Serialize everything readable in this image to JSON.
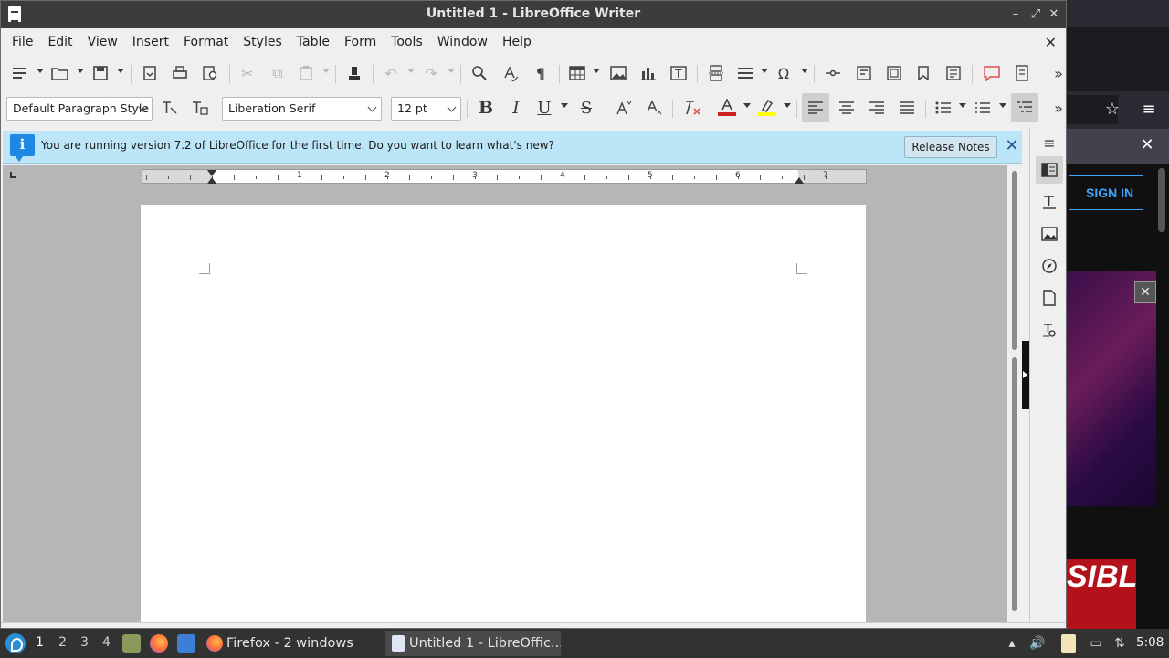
{
  "window": {
    "title": "Untitled 1 - LibreOffice Writer",
    "minimize_glyph": "–",
    "maximize_glyph": "⤢",
    "close_glyph": "✕"
  },
  "menubar": {
    "items": [
      "File",
      "Edit",
      "View",
      "Insert",
      "Format",
      "Styles",
      "Table",
      "Form",
      "Tools",
      "Window",
      "Help"
    ],
    "close_document_glyph": "✕"
  },
  "formatting": {
    "paragraph_style": "Default Paragraph Style",
    "font_name": "Liberation Serif",
    "font_size": "12 pt",
    "font_color": "#c9211e",
    "highlight_color": "#ffff00"
  },
  "infobar": {
    "message": "You are running version 7.2 of LibreOffice for the first time. Do you want to learn what's new?",
    "button_label": "Release Notes",
    "icon_glyph": "i",
    "close_glyph": "✕"
  },
  "ruler": {
    "numbers": [
      "1",
      "2",
      "3",
      "4",
      "5",
      "6",
      "7"
    ]
  },
  "sidebar": {
    "menu_glyph": "≡"
  },
  "background_firefox": {
    "sign_in_label": "SIGN IN",
    "thumbnail_text": "SIBLY TUN"
  },
  "taskbar": {
    "workspaces": [
      "1",
      "2",
      "3",
      "4"
    ],
    "active_workspace": "1",
    "tasks": [
      {
        "label": "Firefox - 2 windows"
      },
      {
        "label": "Untitled 1 - LibreOffic..."
      }
    ],
    "clock": "5:08"
  },
  "colors": {
    "titlebar": "#3c3c3c",
    "infobar": "#bde5f8",
    "taskbar": "#323232",
    "document_background": "#b6b6b6"
  }
}
